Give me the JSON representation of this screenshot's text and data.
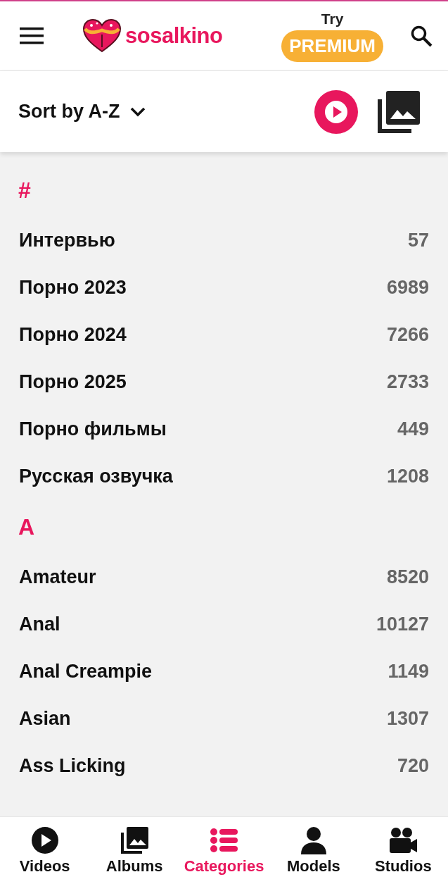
{
  "header": {
    "logo": "sosalkino",
    "try_label": "Try",
    "premium_button": "PREMIUM"
  },
  "sort": {
    "label": "Sort by A-Z"
  },
  "sections": [
    {
      "letter": "#",
      "items": [
        {
          "name": "Интервью",
          "count": "57"
        },
        {
          "name": "Порно 2023",
          "count": "6989"
        },
        {
          "name": "Порно 2024",
          "count": "7266"
        },
        {
          "name": "Порно 2025",
          "count": "2733"
        },
        {
          "name": "Порно фильмы",
          "count": "449"
        },
        {
          "name": "Русская озвучка",
          "count": "1208"
        }
      ]
    },
    {
      "letter": "A",
      "items": [
        {
          "name": "Amateur",
          "count": "8520"
        },
        {
          "name": "Anal",
          "count": "10127"
        },
        {
          "name": "Anal Creampie",
          "count": "1149"
        },
        {
          "name": "Asian",
          "count": "1307"
        },
        {
          "name": "Ass Licking",
          "count": "720"
        }
      ]
    }
  ],
  "nav": [
    {
      "label": "Videos",
      "kind": "play",
      "selected": false
    },
    {
      "label": "Albums",
      "kind": "albums",
      "selected": false
    },
    {
      "label": "Categories",
      "kind": "list",
      "selected": true
    },
    {
      "label": "Models",
      "kind": "person",
      "selected": false
    },
    {
      "label": "Studios",
      "kind": "camera",
      "selected": false
    }
  ]
}
